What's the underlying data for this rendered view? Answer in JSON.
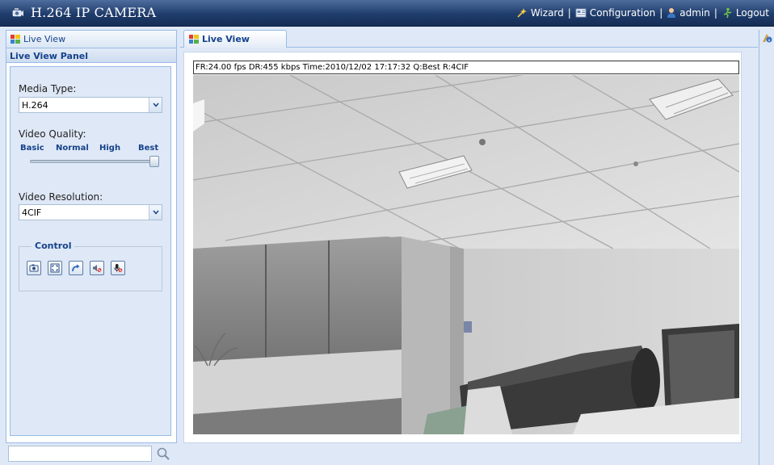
{
  "header": {
    "app_title": "H.264 IP CAMERA",
    "nav": [
      {
        "label": "Wizard",
        "icon": "wizard-icon"
      },
      {
        "label": "Configuration",
        "icon": "configuration-icon"
      },
      {
        "label": "admin",
        "icon": "user-icon"
      },
      {
        "label": "Logout",
        "icon": "logout-icon"
      }
    ]
  },
  "left_panel": {
    "header_title": "Live View",
    "panel_title": "Live View Panel",
    "media_type": {
      "label": "Media Type:",
      "value": "H.264"
    },
    "video_quality": {
      "label": "Video Quality:",
      "levels": [
        "Basic",
        "Normal",
        "High",
        "Best"
      ],
      "selected": "Best"
    },
    "video_resolution": {
      "label": "Video Resolution:",
      "value": "4CIF"
    },
    "control": {
      "legend": "Control",
      "buttons": [
        "snapshot-icon",
        "fullscreen-icon",
        "refresh-icon",
        "speaker-mute-icon",
        "microphone-mute-icon"
      ]
    },
    "search": {
      "value": "",
      "placeholder": ""
    }
  },
  "main": {
    "tab_label": "Live View",
    "osd_text": "FR:24.00 fps  DR:455 kbps Time:2010/12/02 17:17:32 Q:Best R:4CIF"
  },
  "colors": {
    "header_bg": "#1f3c6b",
    "panel_bg": "#dfe8f6",
    "accent_text": "#15428b",
    "border": "#99bbe8"
  }
}
